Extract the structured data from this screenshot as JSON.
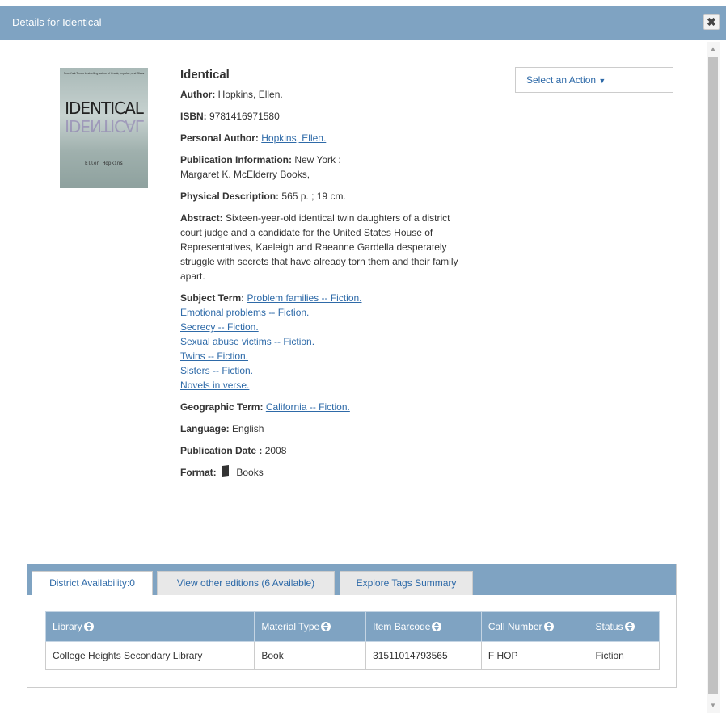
{
  "dialog": {
    "title": "Details for Identical",
    "close_icon": "close-icon"
  },
  "cover": {
    "tagline": "New York Times bestselling author of Crank, Impulse, and Glass",
    "title": "IDENTICAL",
    "author": "Ellen Hopkins"
  },
  "book": {
    "title": "Identical",
    "author_label": "Author:",
    "author": "Hopkins, Ellen.",
    "isbn_label": "ISBN:",
    "isbn": "9781416971580",
    "personal_author_label": "Personal Author:",
    "personal_author": "Hopkins, Ellen.",
    "pubinfo_label": "Publication Information:",
    "pubinfo_line1": "New York :",
    "pubinfo_line2": "Margaret K. McElderry Books,",
    "physical_label": "Physical Description:",
    "physical": "565 p. ; 19 cm.",
    "abstract_label": "Abstract:",
    "abstract": "Sixteen-year-old identical twin daughters of a district court judge and a candidate for the United States House of Representatives, Kaeleigh and Raeanne Gardella desperately struggle with secrets that have already torn them and their family apart.",
    "subject_label": "Subject Term:",
    "subjects": [
      "Problem families -- Fiction.",
      "Emotional problems -- Fiction.",
      "Secrecy -- Fiction.",
      "Sexual abuse victims -- Fiction.",
      "Twins -- Fiction.",
      "Sisters -- Fiction.",
      "Novels in verse."
    ],
    "geo_label": "Geographic Term:",
    "geo": "California -- Fiction.",
    "language_label": "Language:",
    "language": "English",
    "pubdate_label": "Publication Date :",
    "pubdate": "2008",
    "format_label": "Format:",
    "format": "Books",
    "format_icon": "book-icon"
  },
  "action": {
    "label": "Select an Action"
  },
  "tabs": [
    {
      "label": "District Availability:0"
    },
    {
      "label": "View other editions (6 Available)"
    },
    {
      "label": "Explore Tags Summary"
    }
  ],
  "table": {
    "headers": [
      "Library",
      "Material Type",
      "Item Barcode",
      "Call Number",
      "Status"
    ],
    "rows": [
      [
        "College Heights Secondary Library",
        "Book",
        "31511014793565",
        "F HOP",
        "Fiction"
      ]
    ]
  },
  "colors": {
    "header_bg": "#7fa3c2",
    "link": "#2e6aa8"
  }
}
